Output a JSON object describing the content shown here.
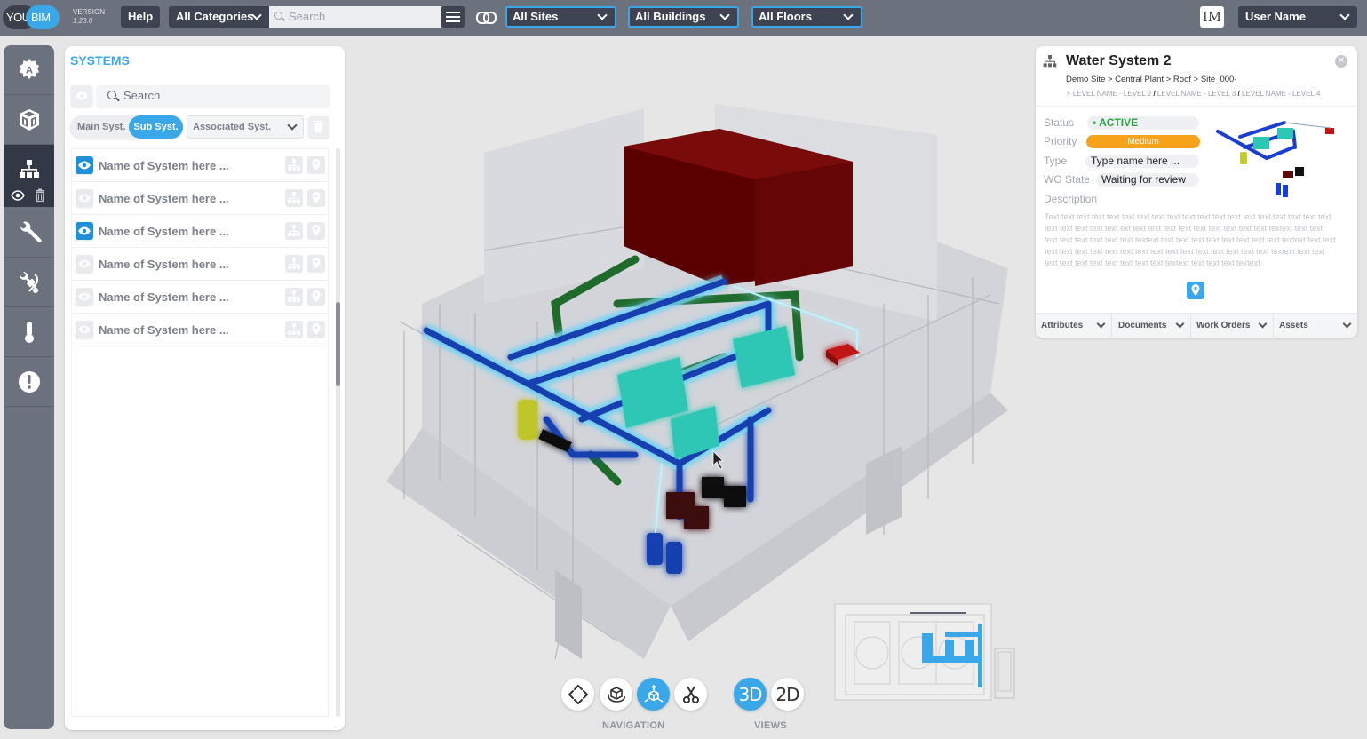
{
  "app": {
    "logo_left": "YOU",
    "logo_right": "BIM",
    "version_label": "VERSION",
    "version_number": "1.23.0"
  },
  "topbar": {
    "help_label": "Help",
    "category_select": "All Categories",
    "search_placeholder": "Search",
    "site_select": "All Sites",
    "building_select": "All Buildings",
    "floor_select": "All Floors",
    "user_initials": "IM",
    "user_select": "User Name"
  },
  "tool_sidebar": {
    "items": [
      {
        "name": "settings-a",
        "icon": "gear-a-icon"
      },
      {
        "name": "model",
        "icon": "cube-icon"
      },
      {
        "name": "systems",
        "icon": "hierarchy-icon",
        "active": true
      },
      {
        "name": "maintenance",
        "icon": "wrench-icon"
      },
      {
        "name": "tools",
        "icon": "tools-icon"
      },
      {
        "name": "sensors",
        "icon": "thermometer-icon"
      },
      {
        "name": "alerts",
        "icon": "alert-icon"
      }
    ]
  },
  "systems_panel": {
    "title": "SYSTEMS",
    "search_placeholder": "Search",
    "toggle_main": "Main Syst.",
    "toggle_sub": "Sub Syst.",
    "associated_select": "Associated Syst.",
    "systems": [
      {
        "name": "Name of System here ...",
        "visible": true
      },
      {
        "name": "Name of System here ...",
        "visible": false
      },
      {
        "name": "Name of System here ...",
        "visible": true
      },
      {
        "name": "Name of System here ...",
        "visible": false
      },
      {
        "name": "Name of System here ...",
        "visible": false
      },
      {
        "name": "Name of System here ...",
        "visible": false
      }
    ]
  },
  "details": {
    "title": "Water System 2",
    "breadcrumb": "Demo Site > Central Plant > Roof > Site_000-",
    "levels": [
      "LEVEL NAME - LEVEL 2",
      "LEVEL NAME - LEVEL 3",
      "LEVEL NAME - LEVEL 4"
    ],
    "status_label": "Status",
    "status_value": "• ACTIVE",
    "priority_label": "Priority",
    "priority_value": "Medium",
    "type_label": "Type",
    "type_value": "Type name here ...",
    "wo_state_label": "WO State",
    "wo_state_value": "Waiting for review",
    "description_label": "Description",
    "description_text": "Text text text text text text text text text text text text text text text text text text text text text text text text ext text text text text text text text text text textext text text text text text text text text textext text text text text text text text text textext text text text text text text text text text text text text text text text text text textext text text text text text text text text text text textext text text text textext.",
    "colors": {
      "status": "#2ea043",
      "priority": "#f7a21b",
      "accent": "#3aa7e8"
    },
    "tabs": [
      "Attributes",
      "Documents",
      "Work Orders",
      "Assets"
    ]
  },
  "bottom_toolbar": {
    "navigation_label": "NAVIGATION",
    "views_label": "VIEWS",
    "navigation_tools": [
      {
        "name": "pan",
        "icon": "pan-arrows-icon"
      },
      {
        "name": "orbit",
        "icon": "orbit-cube-icon"
      },
      {
        "name": "explode",
        "icon": "explode-cube-icon",
        "active": true
      },
      {
        "name": "section",
        "icon": "scissors-icon"
      }
    ],
    "view_3d": "3D",
    "view_2d": "2D",
    "active_view": "3D"
  }
}
